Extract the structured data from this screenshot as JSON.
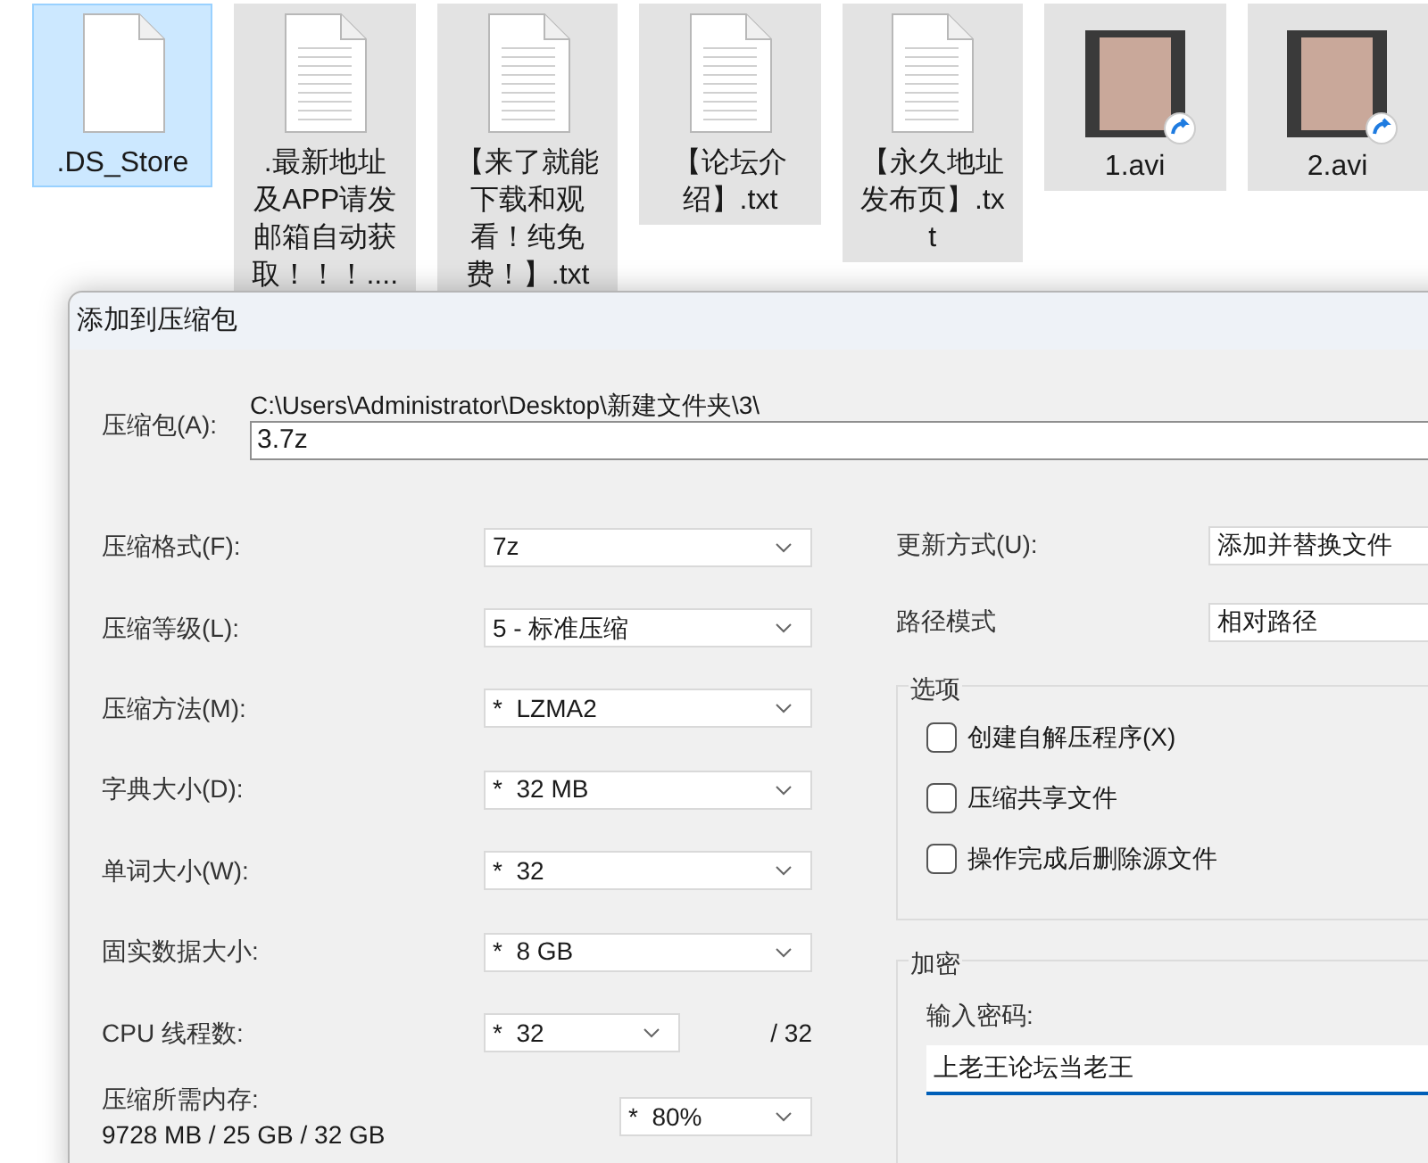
{
  "files": [
    {
      "name": ".DS_Store",
      "kind": "file",
      "selected": true
    },
    {
      "name": ".最新地址及APP请发邮箱自动获取！！！....",
      "kind": "text",
      "selected": false
    },
    {
      "name": "【来了就能下载和观看！纯免费！】.txt",
      "kind": "text",
      "selected": false
    },
    {
      "name": "【论坛介绍】.txt",
      "kind": "text",
      "selected": false
    },
    {
      "name": "【永久地址发布页】.txt",
      "kind": "text",
      "selected": false
    },
    {
      "name": "1.avi",
      "kind": "video",
      "selected": false
    },
    {
      "name": "2.avi",
      "kind": "video",
      "selected": false
    }
  ],
  "dialog": {
    "title": "添加到压缩包",
    "archive": {
      "label": "压缩包(A):",
      "path": "C:\\Users\\Administrator\\Desktop\\新建文件夹\\3\\",
      "value": "3.7z"
    },
    "left_options": [
      {
        "label": "压缩格式(F):",
        "value": "7z"
      },
      {
        "label": "压缩等级(L):",
        "value": "5 - 标准压缩"
      },
      {
        "label": "压缩方法(M):",
        "value": "*  LZMA2"
      },
      {
        "label": "字典大小(D):",
        "value": "*  32 MB"
      },
      {
        "label": "单词大小(W):",
        "value": "*  32"
      },
      {
        "label": "固实数据大小:",
        "value": "*  8 GB"
      }
    ],
    "cpu_threads": {
      "label": "CPU 线程数:",
      "value": "*  32",
      "total": "/ 32"
    },
    "memory": {
      "label": "压缩所需内存:",
      "usage": "9728 MB / 25 GB / 32 GB",
      "value": "*  80%"
    },
    "right_options": [
      {
        "label": "更新方式(U):",
        "value": "添加并替换文件"
      },
      {
        "label": "路径模式",
        "value": "相对路径"
      }
    ],
    "options_group": {
      "title": "选项",
      "checkboxes": [
        {
          "label": "创建自解压程序(X)",
          "checked": false
        },
        {
          "label": "压缩共享文件",
          "checked": false
        },
        {
          "label": "操作完成后删除源文件",
          "checked": false
        }
      ]
    },
    "encryption": {
      "title": "加密",
      "label": "输入密码:",
      "value": "上老王论坛当老王"
    }
  }
}
